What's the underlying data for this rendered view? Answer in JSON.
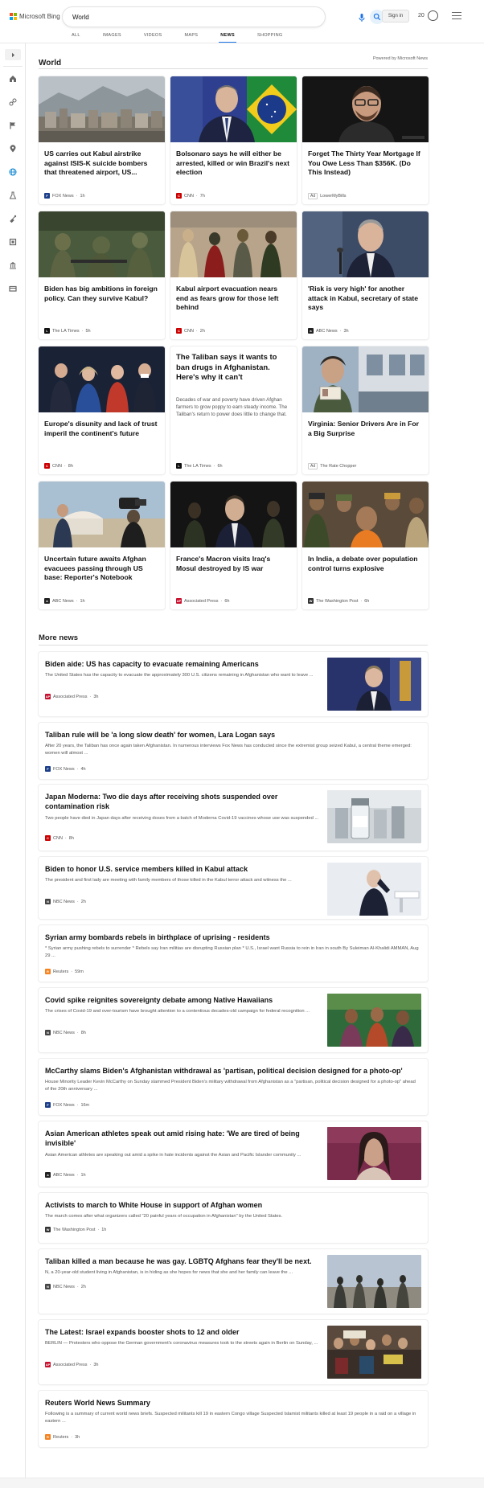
{
  "header": {
    "logo_text": "Microsoft Bing",
    "search_value": "World",
    "signin_label": "Sign in",
    "rewards_count": "20"
  },
  "tabs": [
    {
      "label": "ALL"
    },
    {
      "label": "IMAGES"
    },
    {
      "label": "VIDEOS"
    },
    {
      "label": "MAPS"
    },
    {
      "label": "NEWS"
    },
    {
      "label": "SHOPPING"
    }
  ],
  "active_tab": "NEWS",
  "section": {
    "title": "World",
    "powered_by": "Powered by Microsoft News"
  },
  "grid": [
    {
      "title": "US carries out Kabul airstrike against ISIS-K suicide bombers that threatened airport, US...",
      "source": "FOX News",
      "age": "1h",
      "icon": "fox-news-logo",
      "color": "#1c3e8a"
    },
    {
      "title": "Bolsonaro says he will either be arrested, killed or win Brazil's next election",
      "source": "CNN",
      "age": "7h",
      "icon": "cnn-logo",
      "color": "#cc0000"
    },
    {
      "title": "Forget The Thirty Year Mortgage If You Owe Less Than $356K. (Do This Instead)",
      "source": "LowerMyBills",
      "ad": "Ad",
      "icon": "ad-badge",
      "color": "#888888"
    },
    {
      "title": "Biden has big ambitions in foreign policy. Can they survive Kabul?",
      "source": "The LA Times",
      "age": "5h",
      "icon": "la-times-logo",
      "color": "#111111"
    },
    {
      "title": "Kabul airport evacuation nears end as fears grow for those left behind",
      "source": "CNN",
      "age": "2h",
      "icon": "cnn-logo",
      "color": "#cc0000"
    },
    {
      "title": "'Risk is very high' for another attack in Kabul, secretary of state says",
      "source": "ABC News",
      "age": "3h",
      "icon": "abc-news-logo",
      "color": "#222222"
    },
    {
      "title": "Europe's disunity and lack of trust imperil the continent's future",
      "source": "CNN",
      "age": "8h",
      "icon": "cnn-logo",
      "color": "#cc0000"
    },
    {
      "title": "The Taliban says it wants to ban drugs in Afghanistan. Here's why it can't",
      "snippet": "Decades of war and poverty have driven Afghan farmers to grow poppy to earn steady income. The Taliban's return to power does little to change that.",
      "source": "The LA Times",
      "age": "6h",
      "icon": "la-times-logo",
      "color": "#111111"
    },
    {
      "title": "Virginia: Senior Drivers Are in For a Big Surprise",
      "source": "The Rate Chopper",
      "ad": "Ad",
      "icon": "ad-badge",
      "color": "#888888"
    },
    {
      "title": "Uncertain future awaits Afghan evacuees passing through US base: Reporter's Notebook",
      "source": "ABC News",
      "age": "1h",
      "icon": "abc-news-logo",
      "color": "#222222"
    },
    {
      "title": "France's Macron visits Iraq's Mosul destroyed by IS war",
      "source": "Associated Press",
      "age": "6h",
      "icon": "ap-logo",
      "color": "#c8102e"
    },
    {
      "title": "In India, a debate over population control turns explosive",
      "source": "The Washington Post",
      "age": "6h",
      "icon": "wapo-logo",
      "color": "#333333"
    }
  ],
  "more_news_title": "More news",
  "more_news": [
    {
      "title": "Biden aide: US has capacity to evacuate remaining Americans",
      "snippet": "The United States has the capacity to evacuate the approximately 300 U.S. citizens remaining in Afghanistan who want to leave ...",
      "source": "Associated Press",
      "age": "3h",
      "icon": "ap-logo",
      "color": "#c8102e",
      "has_image": true
    },
    {
      "title": "Taliban rule will be 'a long slow death' for women, Lara Logan says",
      "snippet": "After 20 years, the Taliban has once again taken Afghanistan. In numerous interviews Fox News has conducted since the extremist group seized Kabul, a central theme emerged: women will almost ...",
      "source": "FOX News",
      "age": "4h",
      "icon": "fox-news-logo",
      "color": "#1c3e8a",
      "has_image": false
    },
    {
      "title": "Japan Moderna: Two die days after receiving shots suspended over contamination risk",
      "snippet": "Two people have died in Japan days after receiving doses from a batch of Moderna Covid-19 vaccines whose use was suspended ...",
      "source": "CNN",
      "age": "8h",
      "icon": "cnn-logo",
      "color": "#cc0000",
      "has_image": true
    },
    {
      "title": "Biden to honor U.S. service members killed in Kabul attack",
      "snippet": "The president and first lady are meeting with family members of those killed in the Kabul terror attack and witness the ...",
      "source": "NBC News",
      "age": "2h",
      "icon": "nbc-news-logo",
      "color": "#444444",
      "has_image": true
    },
    {
      "title": "Syrian army bombards rebels in birthplace of uprising - residents",
      "snippet": "* Syrian army pushing rebels to surrender * Rebels say Iran militias are disrupting Russian plan * U.S., Israel want Russia to rein in Iran in south By Suleiman Al-Khalidi AMMAN, Aug 29 ...",
      "source": "Reuters",
      "age": "59m",
      "icon": "reuters-logo",
      "color": "#f5821f",
      "has_image": false
    },
    {
      "title": "Covid spike reignites sovereignty debate among Native Hawaiians",
      "snippet": "The crises of Covid-19 and over-tourism have brought attention to a contentious decades-old campaign for federal recognition ...",
      "source": "NBC News",
      "age": "8h",
      "icon": "nbc-news-logo",
      "color": "#444444",
      "has_image": true
    },
    {
      "title": "McCarthy slams Biden's Afghanistan withdrawal as 'partisan, political decision designed for a photo-op'",
      "snippet": "House Minority Leader Kevin McCarthy on Sunday slammed President Biden's military withdrawal from Afghanistan as a \"partisan, political decision designed for a photo-op\" ahead of the 20th anniversary ...",
      "source": "FOX News",
      "age": "16m",
      "icon": "fox-news-logo",
      "color": "#1c3e8a",
      "has_image": false
    },
    {
      "title": "Asian American athletes speak out amid rising hate: 'We are tired of being invisible'",
      "snippet": "Asian American athletes are speaking out amid a spike in hate incidents against the Asian and Pacific Islander community ...",
      "source": "ABC News",
      "age": "1h",
      "icon": "abc-news-logo",
      "color": "#222222",
      "has_image": true
    },
    {
      "title": "Activists to march to White House in support of Afghan women",
      "snippet": "The march comes after what organizers called \"20 painful years of occupation in Afghanistan\" by the United States.",
      "source": "The Washington Post",
      "age": "1h",
      "icon": "wapo-logo",
      "color": "#333333",
      "has_image": false
    },
    {
      "title": "Taliban killed a man because he was gay. LGBTQ Afghans fear they'll be next.",
      "snippet": "N, a 20-year-old student living in Afghanistan, is in hiding as she hopes for news that she and her family can leave the ...",
      "source": "NBC News",
      "age": "2h",
      "icon": "nbc-news-logo",
      "color": "#444444",
      "has_image": true
    },
    {
      "title": "The Latest: Israel expands booster shots to 12 and older",
      "snippet": "BERLIN — Protesters who oppose the German government's coronavirus measures took to the streets again in Berlin on Sunday, ...",
      "source": "Associated Press",
      "age": "3h",
      "icon": "ap-logo",
      "color": "#c8102e",
      "has_image": true
    },
    {
      "title": "Reuters World News Summary",
      "snippet": "Following is a summary of current world news briefs. Suspected militants kill 19 in eastern Congo village Suspected Islamist militants killed at least 19 people in a raid on a village in eastern ...",
      "source": "Reuters",
      "age": "3h",
      "icon": "reuters-logo",
      "color": "#f5821f",
      "has_image": false
    }
  ],
  "sidebar_icons": [
    "expand-icon",
    "home-icon",
    "sports-icon",
    "flag-icon",
    "location-icon",
    "world-icon",
    "science-icon",
    "technology-icon",
    "entertainment-icon",
    "politics-icon",
    "money-icon"
  ],
  "colors": {
    "accent": "#1a73e8",
    "world_icon": "#0a84d0"
  }
}
